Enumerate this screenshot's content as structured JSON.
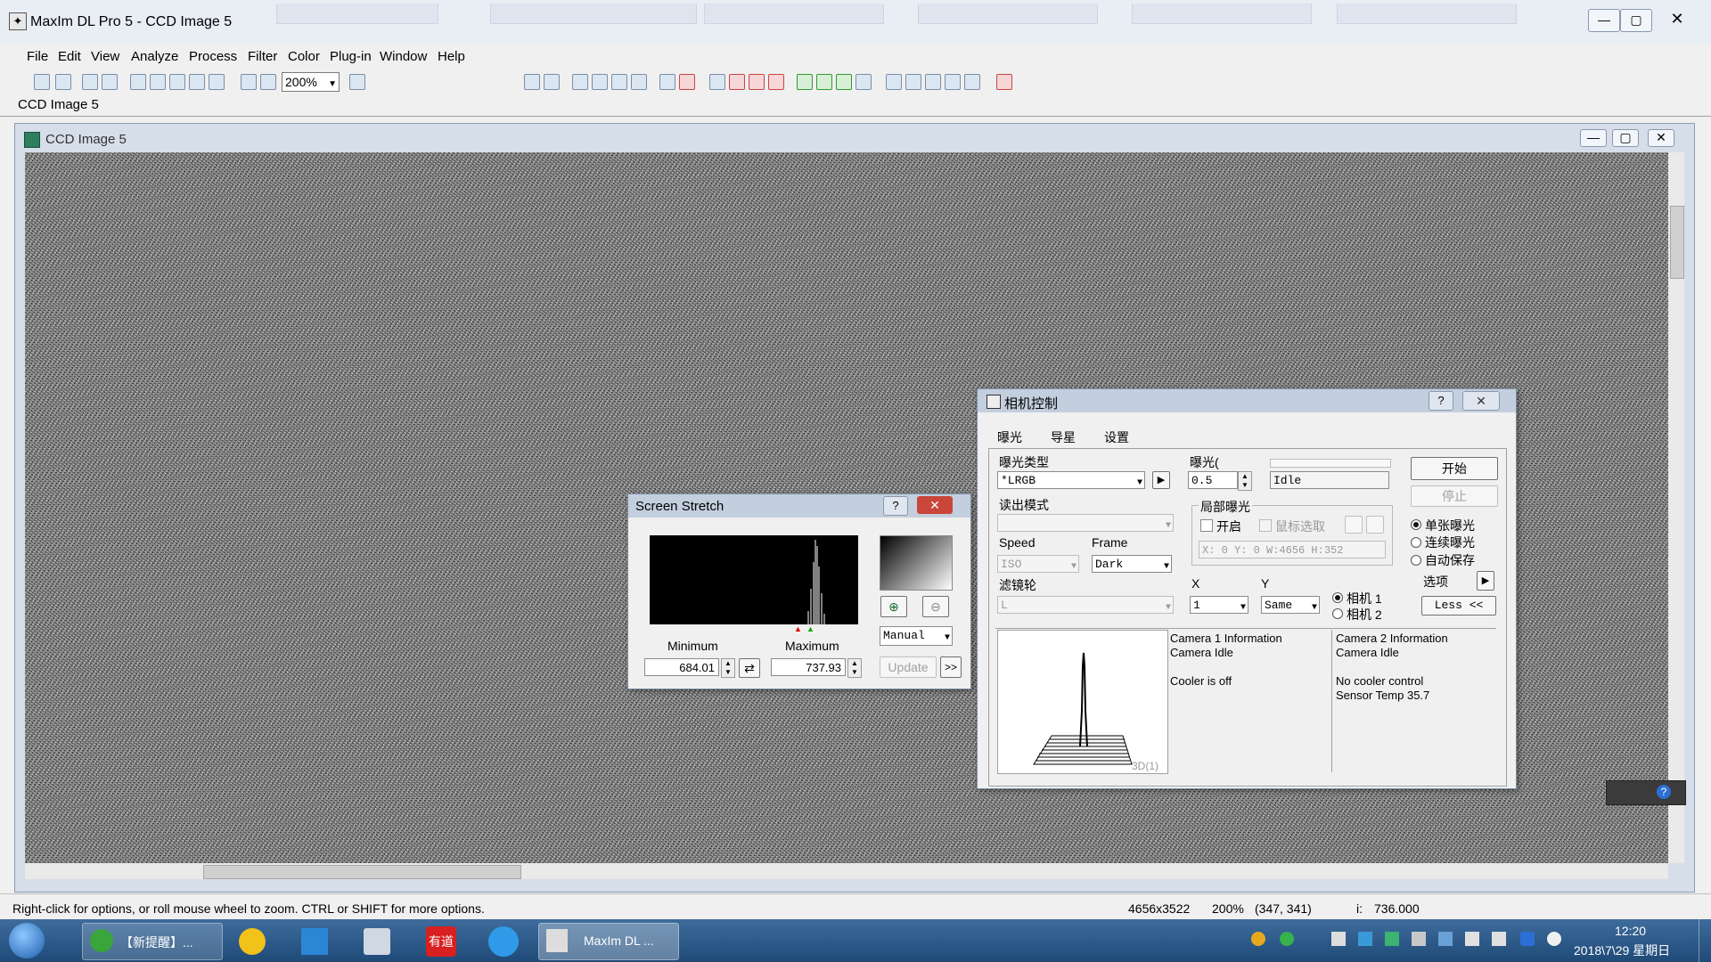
{
  "app": {
    "title": "MaxIm DL Pro 5 - CCD Image 5",
    "window_controls": {
      "minimize": "—",
      "maximize": "▢",
      "close": "✕"
    }
  },
  "menu": [
    "File",
    "Edit",
    "View",
    "Analyze",
    "Process",
    "Filter",
    "Color",
    "Plug-in",
    "Window",
    "Help"
  ],
  "toolbar": {
    "zoom_value": "200%"
  },
  "doc_tab": {
    "label": "CCD Image 5"
  },
  "child_window": {
    "title": "CCD Image 5"
  },
  "screen_stretch": {
    "title": "Screen Stretch",
    "help": "?",
    "close": "✕",
    "minimum_label": "Minimum",
    "maximum_label": "Maximum",
    "minimum_value": "684.01",
    "maximum_value": "737.93",
    "mode": "Manual",
    "update_label": "Update",
    "more_label": ">>"
  },
  "camera_control": {
    "title": "相机控制",
    "help": "?",
    "close": "✕",
    "tabs": [
      "曝光",
      "导星",
      "设置"
    ],
    "exposure_type_label": "曝光类型",
    "exposure_type_value": "*LRGB",
    "exposure_label": "曝光(",
    "exposure_value": "0.5",
    "status_value": "Idle",
    "readout_label": "读出模式",
    "readout_value": "",
    "subframe_label": "局部曝光",
    "subframe_on_label": "开启",
    "subframe_mouse_label": "鼠标选取",
    "subframe_coords": "X:   0 Y:   0 W:4656 H:352",
    "speed_label": "Speed",
    "speed_value": "ISO",
    "frame_label": "Frame",
    "frame_value": "Dark",
    "filter_label": "滤镜轮",
    "filter_value": "L",
    "x_label": "X",
    "x_value": "1",
    "y_label": "Y",
    "y_value": "Same",
    "camera1_label": "相机 1",
    "camera2_label": "相机 2",
    "start_label": "开始",
    "stop_label": "停止",
    "single_label": "单张曝光",
    "continuous_label": "连续曝光",
    "autosave_label": "自动保存",
    "options_label": "选项",
    "less_label": "Less <<",
    "plot_label": "3D(1)",
    "cam1_info": [
      "Camera 1 Information",
      "Camera Idle",
      "",
      "Cooler is off"
    ],
    "cam2_info": [
      "Camera 2 Information",
      "Camera Idle",
      "",
      "No cooler control",
      "Sensor Temp 35.7"
    ]
  },
  "status_bar": {
    "hint": "Right-click for options, or roll mouse wheel to zoom. CTRL or SHIFT for more options.",
    "dimensions": "4656x3522",
    "zoom": "200%",
    "coords": "(347, 341)",
    "intensity_label": "i:",
    "intensity_value": "736.000"
  },
  "taskbar": {
    "item1_label": "【新提醒】...",
    "item2_label": "有道",
    "active_label": "MaxIm DL ...",
    "time": "12:20",
    "date": "2018\\7\\29 星期日"
  },
  "colors": {
    "titlebar": "#e9eef5",
    "taskbar": "#1f4a78",
    "close_red": "#c9463a"
  }
}
